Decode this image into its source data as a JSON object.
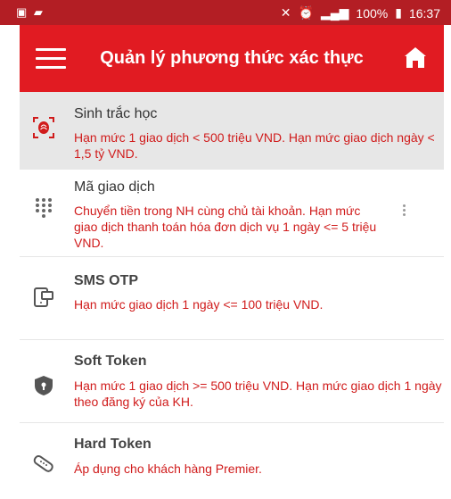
{
  "status_bar": {
    "left_icons": [
      "notification-icon",
      "message-icon"
    ],
    "battery": "100%",
    "time": "16:37"
  },
  "app_bar": {
    "title": "Quản lý phương thức xác thực"
  },
  "methods": [
    {
      "title": "Sinh trắc học",
      "description": "Hạn mức 1 giao dịch < 500 triệu VND. Hạn mức giao dịch ngày < 1,5 tỷ VND.",
      "icon": "fingerprint-icon"
    },
    {
      "title": "Mã giao dịch",
      "description": "Chuyển tiền trong NH cùng chủ tài khoản. Hạn mức giao dịch thanh toán hóa đơn dịch vụ 1 ngày <= 5 triệu VND.",
      "icon": "keypad-icon"
    },
    {
      "title": "SMS OTP",
      "description": "Hạn mức giao dịch 1 ngày <= 100 triệu VND.",
      "icon": "sms-phone-icon"
    },
    {
      "title": "Soft Token",
      "description": "Hạn mức 1 giao dịch >= 500 triệu VND. Hạn mức giao dịch 1 ngày theo đăng ký của KH.",
      "icon": "shield-icon"
    },
    {
      "title": "Hard Token",
      "description": "Áp dụng cho khách hàng Premier.",
      "icon": "token-device-icon"
    }
  ],
  "colors": {
    "status_bar": "#b31e24",
    "app_bar": "#e11b22",
    "description_text": "#d01b1b",
    "selected_row": "#e7e7e7"
  }
}
